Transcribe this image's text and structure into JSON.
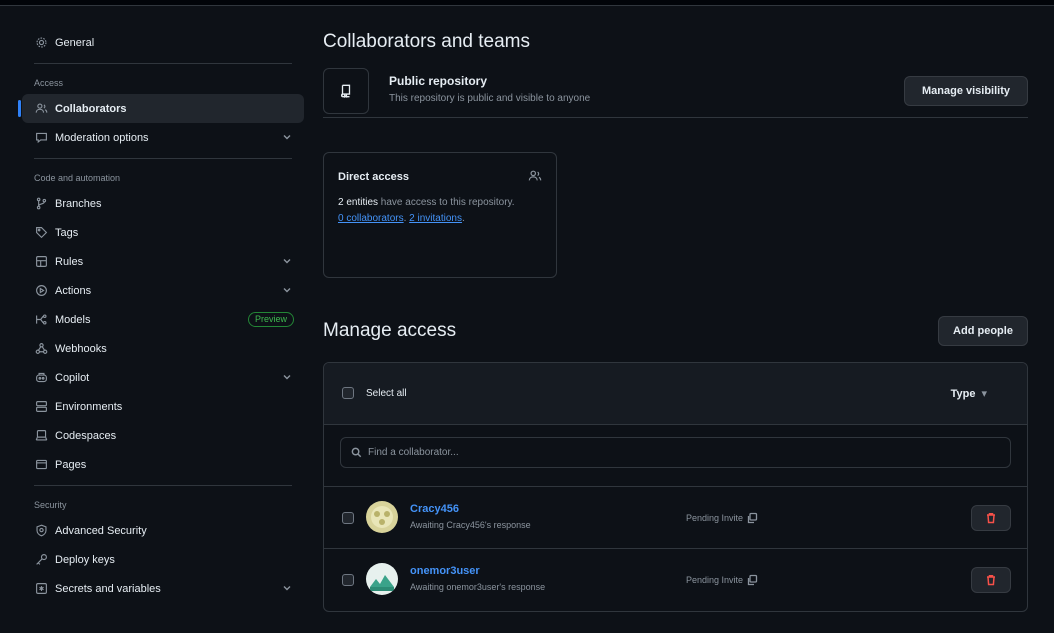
{
  "sidebar": {
    "general": "General",
    "section_access": "Access",
    "collaborators": "Collaborators",
    "moderation": "Moderation options",
    "section_code": "Code and automation",
    "branches": "Branches",
    "tags": "Tags",
    "rules": "Rules",
    "actions": "Actions",
    "models": "Models",
    "models_badge": "Preview",
    "webhooks": "Webhooks",
    "copilot": "Copilot",
    "environments": "Environments",
    "codespaces": "Codespaces",
    "pages": "Pages",
    "section_security": "Security",
    "advanced_security": "Advanced Security",
    "deploy_keys": "Deploy keys",
    "secrets": "Secrets and variables"
  },
  "main": {
    "title": "Collaborators and teams",
    "visibility": {
      "title": "Public repository",
      "description": "This repository is public and visible to anyone",
      "button": "Manage visibility"
    },
    "direct_access": {
      "title": "Direct access",
      "count_text": "2 entities",
      "text_mid": " have access to this repository. ",
      "collaborators_link": "0 collaborators",
      "sep": ". ",
      "invitations_link": "2 invitations",
      "end": "."
    },
    "manage": {
      "title": "Manage access",
      "add_button": "Add people",
      "select_all": "Select all",
      "type_filter": "Type",
      "search_placeholder": "Find a collaborator..."
    },
    "collaborators": [
      {
        "name": "Cracy456",
        "status": "Awaiting Cracy456's response",
        "state": "Pending Invite"
      },
      {
        "name": "onemor3user",
        "status": "Awaiting onemor3user's response",
        "state": "Pending Invite"
      }
    ]
  },
  "colors": {
    "accent": "#2f81f7",
    "link": "#4493f8",
    "danger": "#f85149",
    "background": "#0d1117"
  }
}
